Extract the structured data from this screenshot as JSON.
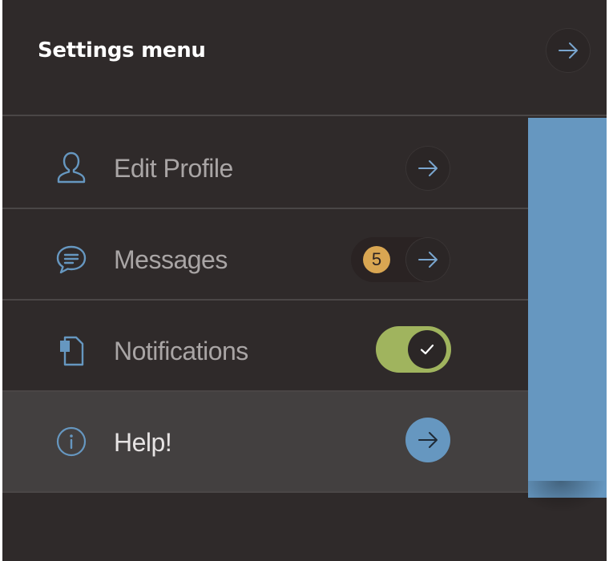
{
  "header": {
    "title": "Settings menu",
    "action_icon": "arrow-right-icon"
  },
  "menu": {
    "items": [
      {
        "label": "Edit Profile",
        "icon": "user-icon",
        "control": "arrow-button"
      },
      {
        "label": "Messages",
        "icon": "chat-bubble-icon",
        "control": "badge-arrow-button",
        "badge": "5"
      },
      {
        "label": "Notifications",
        "icon": "document-icon",
        "control": "toggle",
        "toggle_on": true
      },
      {
        "label": "Help!",
        "icon": "info-icon",
        "control": "arrow-button",
        "active": true
      }
    ]
  },
  "colors": {
    "background": "#2f2a2a",
    "accent_blue": "#6697c0",
    "toggle_green": "#a0b45e",
    "badge_gold": "#d9a652",
    "active_row": "#434040"
  }
}
